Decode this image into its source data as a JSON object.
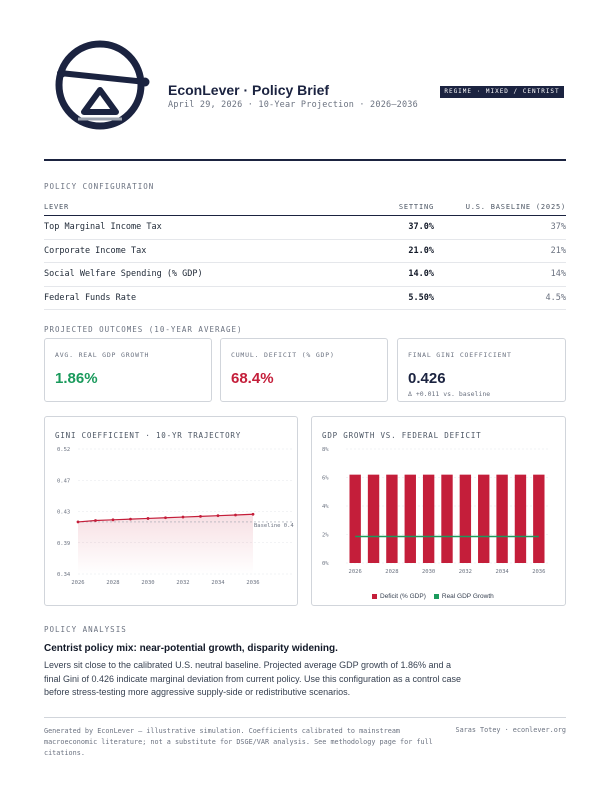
{
  "header": {
    "title": "EconLever · Policy Brief",
    "subtitle": "April 29, 2026 · 10-Year Projection · 2026–2036",
    "regime_badge": "REGIME · MIXED / CENTRIST",
    "logo_icon": "seesaw-balance-icon"
  },
  "colors": {
    "navy": "#1b2340",
    "red": "#c41e3a",
    "green": "#1a9a5c"
  },
  "policy_config": {
    "section_label": "POLICY CONFIGURATION",
    "columns": [
      "LEVER",
      "SETTING",
      "U.S. BASELINE (2025)"
    ],
    "rows": [
      {
        "lever": "Top Marginal Income Tax",
        "setting": "37.0%",
        "baseline": "37%"
      },
      {
        "lever": "Corporate Income Tax",
        "setting": "21.0%",
        "baseline": "21%"
      },
      {
        "lever": "Social Welfare Spending (% GDP)",
        "setting": "14.0%",
        "baseline": "14%"
      },
      {
        "lever": "Federal Funds Rate",
        "setting": "5.50%",
        "baseline": "4.5%"
      }
    ]
  },
  "outcomes": {
    "section_label": "PROJECTED OUTCOMES (10-YEAR AVERAGE)",
    "cards": [
      {
        "label": "AVG. REAL GDP GROWTH",
        "value": "1.86%",
        "note": ""
      },
      {
        "label": "CUMUL. DEFICIT (% GDP)",
        "value": "68.4%",
        "note": ""
      },
      {
        "label": "FINAL GINI COEFFICIENT",
        "value": "0.426",
        "note": "Δ +0.011 vs. baseline"
      }
    ]
  },
  "chart_data": [
    {
      "type": "line",
      "title": "GINI COEFFICIENT · 10-YR TRAJECTORY",
      "x": [
        2026,
        2027,
        2028,
        2029,
        2030,
        2031,
        2032,
        2033,
        2034,
        2035,
        2036
      ],
      "x_ticks": [
        "2026",
        "2028",
        "2030",
        "2032",
        "2034",
        "2036"
      ],
      "y_ticks": [
        "0.52",
        "0.47",
        "0.43",
        "0.39",
        "0.34"
      ],
      "ylim": [
        0.34,
        0.52
      ],
      "series": [
        {
          "values": [
            0.415,
            0.417,
            0.418,
            0.419,
            0.42,
            0.421,
            0.422,
            0.423,
            0.424,
            0.425,
            0.426
          ]
        }
      ],
      "baseline": {
        "label": "Baseline 0.4",
        "value": 0.415
      },
      "grid": true
    },
    {
      "type": "bar",
      "title": "GDP GROWTH VS. FEDERAL DEFICIT",
      "categories": [
        "2026",
        "2027",
        "2028",
        "2029",
        "2030",
        "2031",
        "2032",
        "2033",
        "2034",
        "2035",
        "2036"
      ],
      "x_ticks": [
        "2026",
        "2028",
        "2030",
        "2032",
        "2034",
        "2036"
      ],
      "y_ticks": [
        "8%",
        "6%",
        "4%",
        "2%",
        "0%"
      ],
      "ylim": [
        0,
        8
      ],
      "series": [
        {
          "name": "Deficit (% GDP)",
          "values": [
            6.2,
            6.2,
            6.2,
            6.2,
            6.2,
            6.2,
            6.2,
            6.2,
            6.2,
            6.2,
            6.2
          ]
        },
        {
          "name": "Real GDP Growth",
          "values": [
            1.86,
            1.86,
            1.86,
            1.86,
            1.86,
            1.86,
            1.86,
            1.86,
            1.86,
            1.86,
            1.86
          ]
        }
      ],
      "legend_position": "bottom",
      "grid": true
    }
  ],
  "analysis": {
    "section_label": "POLICY ANALYSIS",
    "headline": "Centrist policy mix: near-potential growth, disparity widening.",
    "body": "Levers sit close to the calibrated U.S. neutral baseline. Projected average GDP growth of 1.86% and a final Gini of 0.426 indicate marginal deviation from current policy. Use this configuration as a control case before stress-testing more aggressive supply-side or redistributive scenarios."
  },
  "footer": {
    "disclaimer": "Generated by EconLever — illustrative simulation. Coefficients calibrated to mainstream macroeconomic literature; not a substitute for DSGE/VAR analysis. See methodology page for full citations.",
    "credit": "Saras Totey · econlever.org"
  }
}
